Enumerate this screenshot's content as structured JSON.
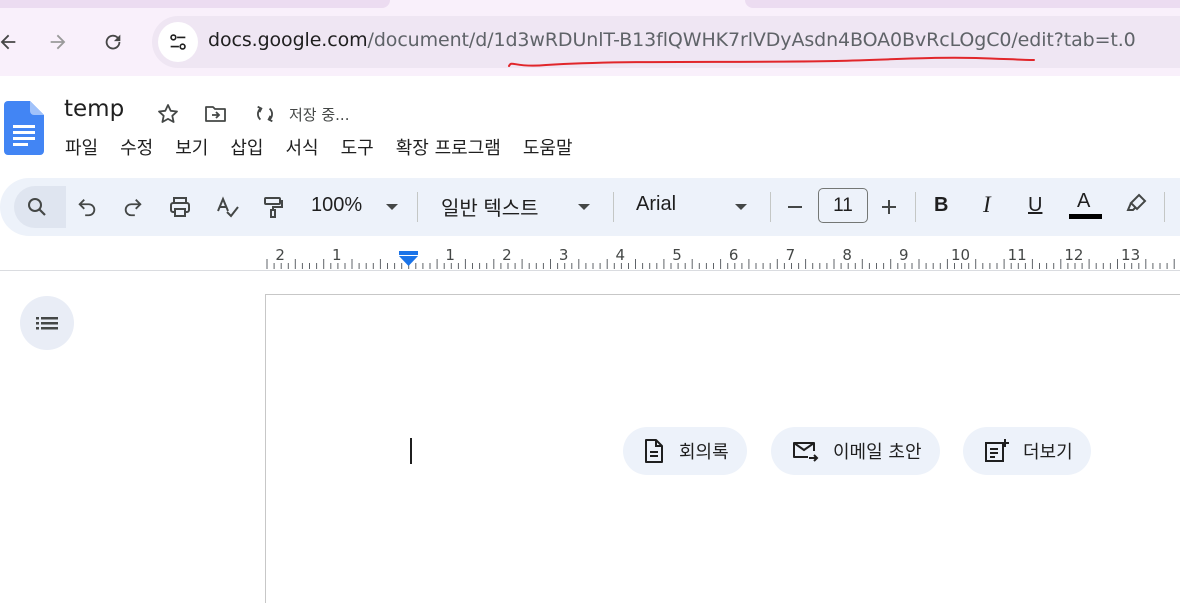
{
  "browser": {
    "url_host": "docs.google.com",
    "url_path": "/document/d/1d3wRDUnlT-B13flQWHK7rlVDyAsdn4BOA0BvRcLOgC0/edit?tab=t.0",
    "annotation_color": "#e1262b"
  },
  "doc": {
    "title": "temp",
    "save_status": "저장 중..."
  },
  "menu": {
    "items": [
      "파일",
      "수정",
      "보기",
      "삽입",
      "서식",
      "도구",
      "확장 프로그램",
      "도움말"
    ]
  },
  "toolbar": {
    "zoom": "100%",
    "style": "일반 텍스트",
    "font": "Arial",
    "font_size": "11",
    "bold": "B",
    "italic": "I",
    "underline": "U",
    "text_color_letter": "A",
    "text_color": "#000000"
  },
  "ruler": {
    "labels": [
      "2",
      "1",
      "1",
      "2",
      "3",
      "4",
      "5",
      "6",
      "7",
      "8",
      "9",
      "10",
      "11",
      "12",
      "13"
    ]
  },
  "chips": [
    {
      "label": "회의록",
      "icon": "document-icon"
    },
    {
      "label": "이메일 초안",
      "icon": "email-send-icon"
    },
    {
      "label": "더보기",
      "icon": "note-add-icon"
    }
  ],
  "colors": {
    "browser_bg": "#f9f0fb",
    "omnibox_bg": "#efe6f3",
    "toolbar_bg": "#edf2fa",
    "docs_blue": "#4285f4"
  }
}
